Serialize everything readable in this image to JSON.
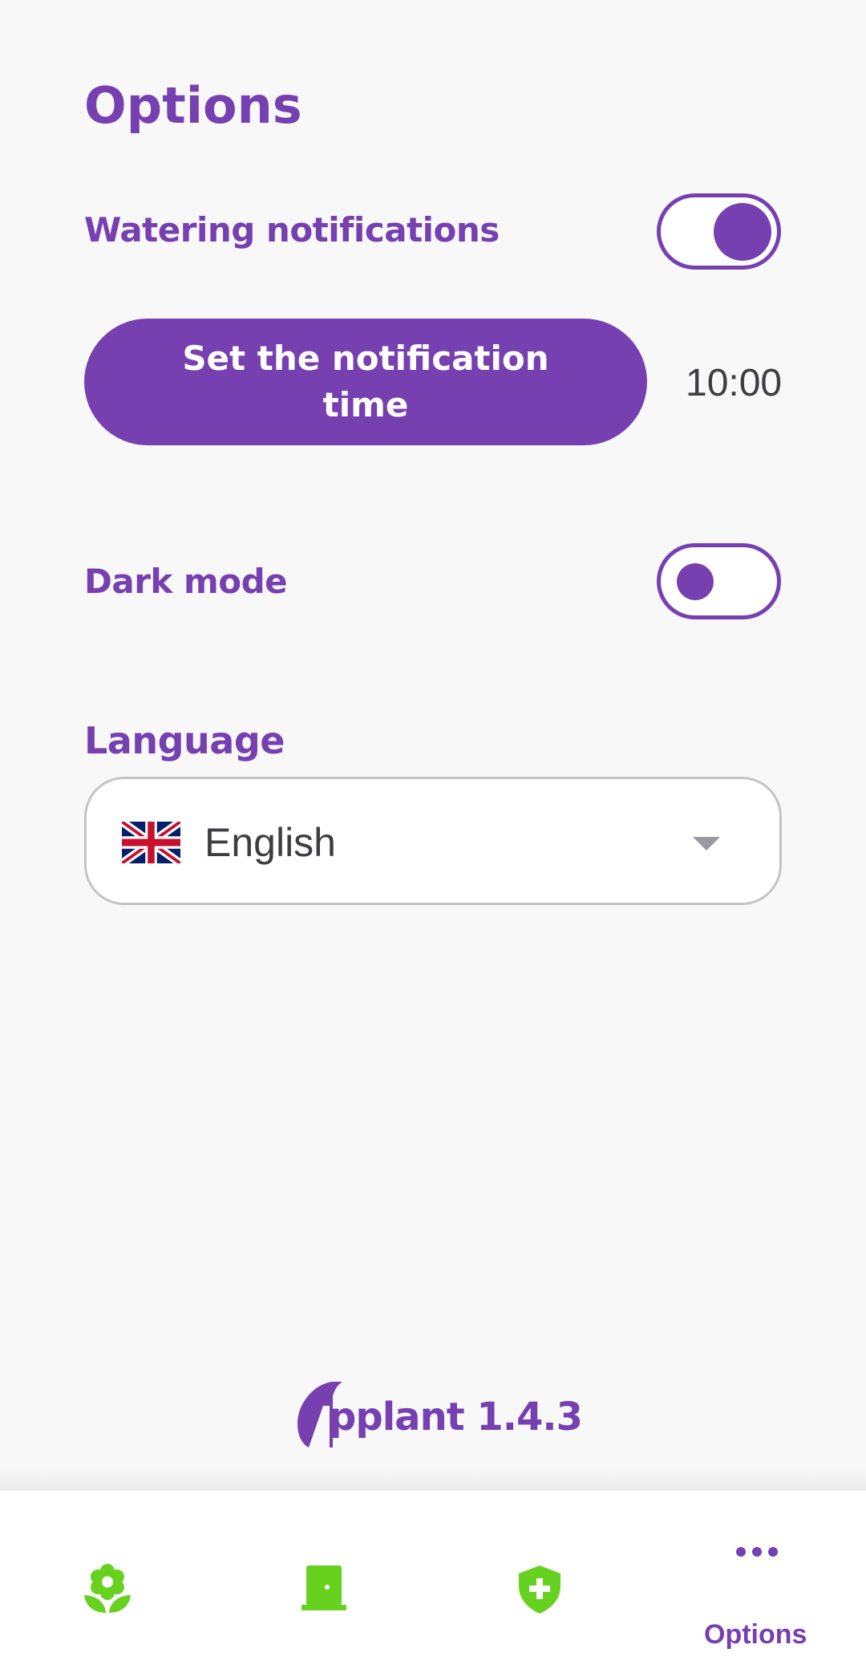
{
  "page": {
    "title": "Options"
  },
  "watering": {
    "label": "Watering notifications",
    "enabled": true
  },
  "notification_time": {
    "button_label": "Set the notification time",
    "value": "10:00"
  },
  "dark_mode": {
    "label": "Dark mode",
    "enabled": false
  },
  "language": {
    "label": "Language",
    "selected": "English",
    "flag_icon": "uk-flag-icon"
  },
  "footer": {
    "app_name": "Applant",
    "version": "1.4.3",
    "logo_text": "pplant 1.4.3"
  },
  "bottom_nav": {
    "items": [
      {
        "icon": "flower-icon",
        "label": ""
      },
      {
        "icon": "door-icon",
        "label": ""
      },
      {
        "icon": "shield-plus-icon",
        "label": ""
      },
      {
        "icon": "more-dots-icon",
        "label": "Options",
        "active": true
      }
    ]
  },
  "colors": {
    "primary": "#7640b0",
    "nav_icon": "#66d11f",
    "background": "#f8f8f9",
    "text_gray": "#3d3d42"
  }
}
